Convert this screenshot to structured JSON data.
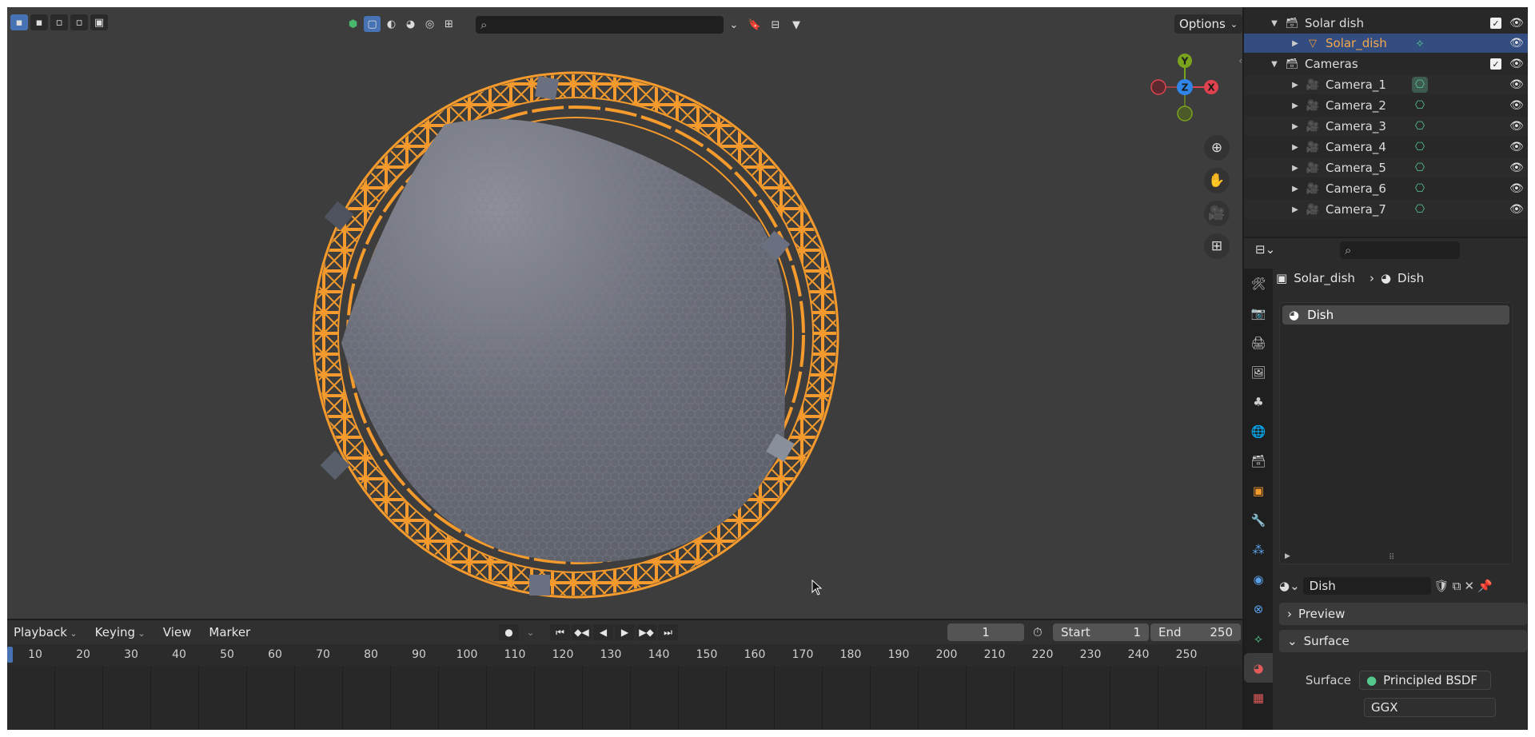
{
  "viewport": {
    "header": {
      "search_placeholder": "",
      "options_label": "Options"
    },
    "gizmo": {
      "y_label": "Y",
      "x_label": "X",
      "z_label": "Z"
    },
    "nav_icons": [
      "zoom-icon",
      "hand-icon",
      "camera-view-icon",
      "grid-icon"
    ]
  },
  "timeline": {
    "menu": {
      "playback": "Playback",
      "keying": "Keying",
      "view": "View",
      "marker": "Marker"
    },
    "current_frame": "1",
    "start_label": "Start",
    "start_value": "1",
    "end_label": "End",
    "end_value": "250",
    "ruler": [
      "10",
      "20",
      "30",
      "40",
      "50",
      "60",
      "70",
      "80",
      "90",
      "100",
      "110",
      "120",
      "130",
      "140",
      "150",
      "160",
      "170",
      "180",
      "190",
      "200",
      "210",
      "220",
      "230",
      "240",
      "250"
    ]
  },
  "outliner": {
    "rows": [
      {
        "label": "Solar dish",
        "kind": "collection"
      },
      {
        "label": "Solar_dish",
        "kind": "mesh",
        "selected": true
      },
      {
        "label": "Cameras",
        "kind": "collection"
      },
      {
        "label": "Camera_1",
        "kind": "camera"
      },
      {
        "label": "Camera_2",
        "kind": "camera"
      },
      {
        "label": "Camera_3",
        "kind": "camera"
      },
      {
        "label": "Camera_4",
        "kind": "camera"
      },
      {
        "label": "Camera_5",
        "kind": "camera"
      },
      {
        "label": "Camera_6",
        "kind": "camera"
      },
      {
        "label": "Camera_7",
        "kind": "camera"
      }
    ]
  },
  "properties": {
    "search_placeholder": "",
    "breadcrumb": {
      "object": "Solar_dish",
      "material": "Dish"
    },
    "slot": "Dish",
    "material_name": "Dish",
    "preview_label": "Preview",
    "surface_panel_label": "Surface",
    "surface_label": "Surface",
    "surface_value": "Principled BSDF",
    "distribution_value": "GGX"
  },
  "colors": {
    "accent_blue": "#4772b3",
    "selection_orange": "#f59a2c",
    "outliner_selected_text": "#f5a84a",
    "axis_x": "#e0434f",
    "axis_y": "#7aa31e",
    "axis_z": "#2f86e8"
  }
}
